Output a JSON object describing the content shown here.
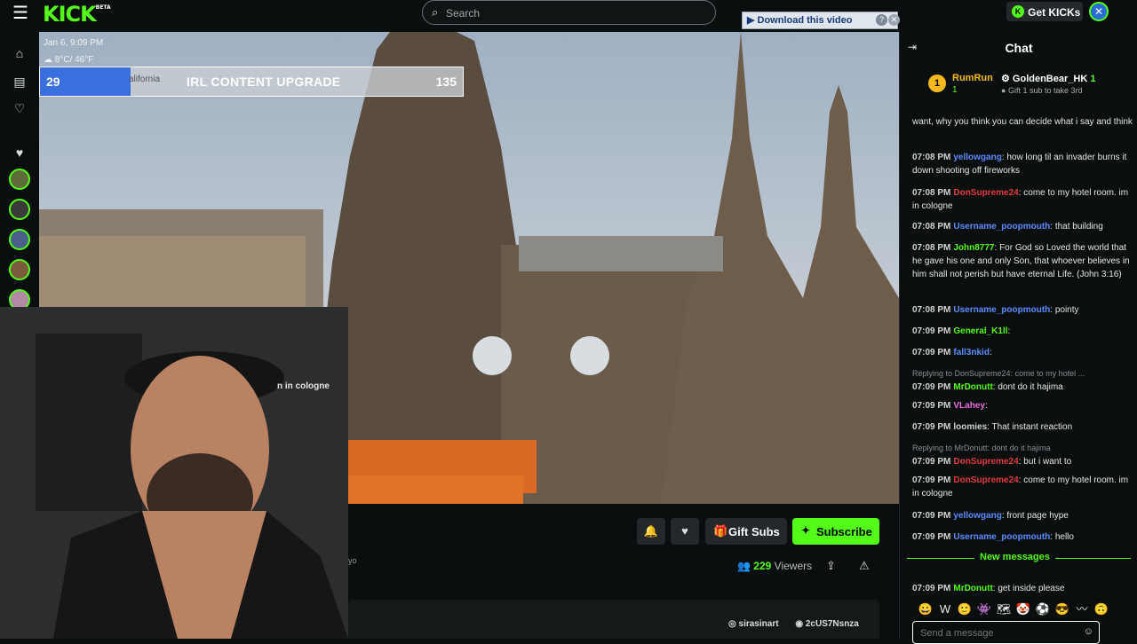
{
  "topbar": {
    "logo": "KICK",
    "logo_beta": "BETA",
    "search_placeholder": "Search",
    "download_label": "Download this video",
    "download_help": "?",
    "download_close": "✕",
    "get_kicks": "Get KICKs"
  },
  "video": {
    "date": "Jan 6, 9:09 PM",
    "temp": "8°C/ 46°F",
    "goal": {
      "current": "29",
      "target": "135",
      "title": "IRL CONTENT UPGRADE",
      "location": "alifornia",
      "progress": 0.215
    },
    "cam_caption": "n in cologne"
  },
  "stream": {
    "gift_label": "Gift Subs",
    "subscribe_label": "Subscribe",
    "viewers_count": "229",
    "viewers_label": "Viewers",
    "category_fragment": "yo",
    "socials": [
      "sirasinart",
      "2cUS7Nsnza"
    ]
  },
  "chat": {
    "title": "Chat",
    "pinned": {
      "rank": "1",
      "user1": "RumRun",
      "user1_count": "1",
      "user2": "GoldenBear_HK",
      "user2_count": "1",
      "gift_text": "Gift 1 sub to take 3rd"
    },
    "messages": [
      {
        "ts": "",
        "user": "",
        "color": "#ffffff",
        "text": "want, why you think you can decide what i say and think"
      },
      {
        "ts": "07:08 PM",
        "user": "yellowgang",
        "color": "#5b8cff",
        "text": "how long til an invader burns it down shooting off fireworks"
      },
      {
        "ts": "07:08 PM",
        "user": "DonSupreme24",
        "color": "#e23b3b",
        "text": "come to my hotel room. im in cologne"
      },
      {
        "ts": "07:08 PM",
        "user": "Username_poopmouth",
        "color": "#5b8cff",
        "text": "that building"
      },
      {
        "ts": "07:08 PM",
        "user": "John8777",
        "color": "#53fc18",
        "text": "For God so Loved the world that he gave his one and only Son, that whoever believes in him shall not perish but have eternal Life. (John 3:16)"
      },
      {
        "ts": "07:08 PM",
        "user": "Username_poopmouth",
        "color": "#5b8cff",
        "text": "pointy"
      },
      {
        "ts": "07:09 PM",
        "user": "General_K1ll",
        "color": "#53fc18",
        "text": ""
      },
      {
        "ts": "07:09 PM",
        "user": "fall3nkid",
        "color": "#5b8cff",
        "text": ""
      },
      {
        "ts": "07:09 PM",
        "user": "MrDonutt",
        "color": "#53fc18",
        "text": "dont do it hajima",
        "reply": "Replying to DonSupreme24: come to my hotel ..."
      },
      {
        "ts": "07:09 PM",
        "user": "VLahey",
        "color": "#e86bd8",
        "text": ""
      },
      {
        "ts": "07:09 PM",
        "user": "loomies",
        "color": "#d2d2d2",
        "text": "That instant reaction"
      },
      {
        "ts": "07:09 PM",
        "user": "DonSupreme24",
        "color": "#e23b3b",
        "text": "but i want to",
        "reply": "Replying to MrDonutt: dont do it hajima"
      },
      {
        "ts": "07:09 PM",
        "user": "DonSupreme24",
        "color": "#e23b3b",
        "text": "come to my hotel room. im in cologne"
      },
      {
        "ts": "07:09 PM",
        "user": "yellowgang",
        "color": "#5b8cff",
        "text": "front page hype"
      },
      {
        "ts": "07:09 PM",
        "user": "Username_poopmouth",
        "color": "#5b8cff",
        "text": "hello"
      },
      {
        "ts": "07:09 PM",
        "user": "MrDonutt",
        "color": "#53fc18",
        "text": "get inside please"
      }
    ],
    "new_messages": "New messages",
    "input_placeholder": "Send a message"
  },
  "colors": {
    "accent": "#53fc18",
    "bg": "#0b0e0f"
  }
}
